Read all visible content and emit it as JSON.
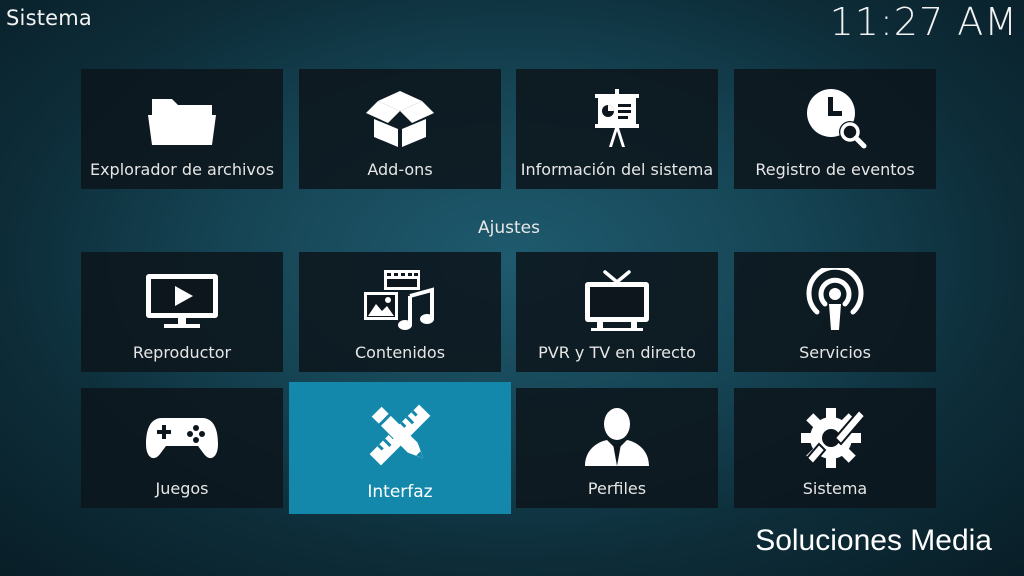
{
  "header": {
    "title": "Sistema",
    "clock": "11:27 AM"
  },
  "top_row": [
    {
      "label": "Explorador de archivos",
      "icon": "folder-icon"
    },
    {
      "label": "Add-ons",
      "icon": "open-box-icon"
    },
    {
      "label": "Información del sistema",
      "icon": "presentation-board-icon"
    },
    {
      "label": "Registro de eventos",
      "icon": "clock-search-icon"
    }
  ],
  "settings": {
    "section_title": "Ajustes",
    "items": [
      {
        "label": "Reproductor",
        "icon": "tv-play-icon"
      },
      {
        "label": "Contenidos",
        "icon": "media-library-icon"
      },
      {
        "label": "PVR y TV en directo",
        "icon": "antenna-tv-icon"
      },
      {
        "label": "Servicios",
        "icon": "podcast-broadcast-icon"
      },
      {
        "label": "Juegos",
        "icon": "gamepad-icon"
      },
      {
        "label": "Interfaz",
        "icon": "pencil-ruler-icon",
        "focused": true
      },
      {
        "label": "Perfiles",
        "icon": "user-profile-icon"
      },
      {
        "label": "Sistema",
        "icon": "gear-wrench-icon"
      }
    ]
  },
  "colors": {
    "focus": "#1488ab",
    "tile_background": "#0c161c"
  },
  "watermark": "Soluciones Media"
}
